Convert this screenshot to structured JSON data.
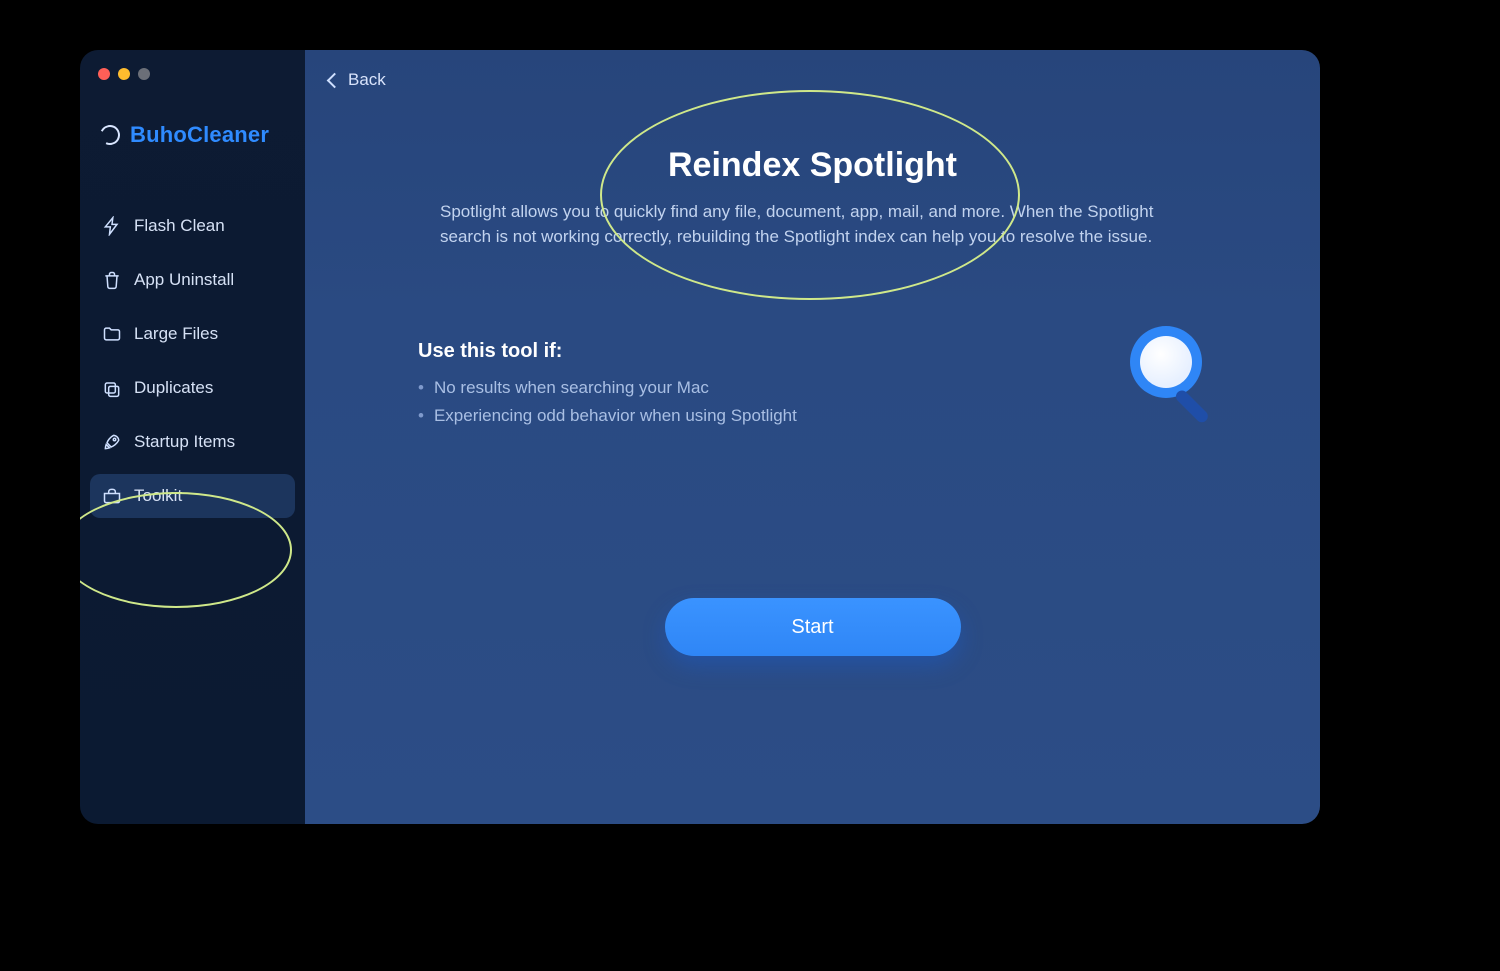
{
  "app": {
    "name": "BuhoCleaner"
  },
  "sidebar": {
    "items": [
      {
        "label": "Flash Clean"
      },
      {
        "label": "App Uninstall"
      },
      {
        "label": "Large Files"
      },
      {
        "label": "Duplicates"
      },
      {
        "label": "Startup Items"
      },
      {
        "label": "Toolkit"
      }
    ]
  },
  "content": {
    "back_label": "Back",
    "title": "Reindex Spotlight",
    "description": "Spotlight allows you to quickly find any file, document, app, mail, and more. When the Spotlight search is not working correctly, rebuilding the Spotlight index can help you to resolve the issue.",
    "section_title": "Use this tool if:",
    "bullets": [
      "No results when searching your Mac",
      "Experiencing odd behavior when using Spotlight"
    ],
    "start_label": "Start"
  }
}
